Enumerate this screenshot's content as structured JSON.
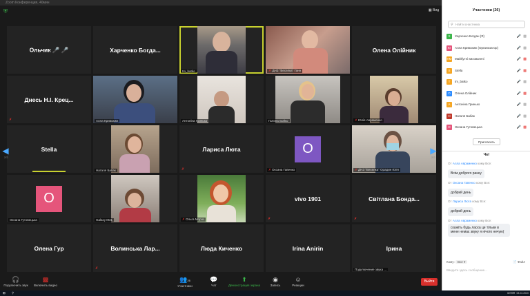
{
  "window": {
    "title": "Zoom Конференция, 40мин"
  },
  "top": {
    "view_label": "Вид"
  },
  "grid": {
    "tiles": [
      {
        "name": "Ольчик 🎤 🎤",
        "label": ""
      },
      {
        "name": "Харченко Богда...",
        "label": ""
      },
      {
        "name": "",
        "label": "tm_batko"
      },
      {
        "name": "",
        "label": "ДНЗ \"Веселка\" Ганн"
      },
      {
        "name": "Олена Олійник",
        "label": ""
      },
      {
        "name": "Днесь Н.І. Крец...",
        "label": ""
      },
      {
        "name": "",
        "label": "Алла Кривохиж"
      },
      {
        "name": "",
        "label": "Антоніна Гринько"
      },
      {
        "name": "",
        "label": "Галина Бойко"
      },
      {
        "name": "",
        "label": "Юлія Авраменко"
      },
      {
        "name": "Stella",
        "label": ""
      },
      {
        "name": "",
        "label": "Наталя Бабак"
      },
      {
        "name": "Лариса Люта",
        "label": ""
      },
      {
        "name": "",
        "label": "Оксана Гавенко"
      },
      {
        "name": "",
        "label": "ДНЗ \"Веселка\" Орадин Юля"
      },
      {
        "name": "",
        "label": "Оксана Гутовецька"
      },
      {
        "name": "",
        "label": "Galaxy M31"
      },
      {
        "name": "",
        "label": "Ольга Мороз"
      },
      {
        "name": "vivo 1901",
        "label": ""
      },
      {
        "name": "Світлана Бонда...",
        "label": ""
      },
      {
        "name": "Олена Гур",
        "label": ""
      },
      {
        "name": "Волинська Лар...",
        "label": ""
      },
      {
        "name": "Люда Киченко",
        "label": ""
      },
      {
        "name": "Irina Anirin",
        "label": ""
      },
      {
        "name": "Ірина",
        "label": "Подключение звука ..."
      }
    ],
    "avatar_letters": {
      "oksana_havenko": "O",
      "oksana_gutovetska": "O"
    },
    "page_left": "2/2",
    "page_right": "2/2"
  },
  "toolbar": {
    "audio": "Подключить звук",
    "video": "Включить видео",
    "participants": "Участники",
    "participants_count": "26",
    "chat": "Чат",
    "share": "Демонстрация экрана",
    "record": "Запись",
    "reactions": "Реакции",
    "end": "Выйти"
  },
  "panel": {
    "title": "Участники (26)",
    "search_placeholder": "Найти участника",
    "participants": [
      {
        "initial": "Х",
        "name": "Харченко Богдан (Я)",
        "color": "#3bb54a"
      },
      {
        "initial": "Ю",
        "name": "Алла Кривохиж (Организатор)",
        "color": "#e5557b"
      },
      {
        "initial": "НМ",
        "name": "Майбутні вихователі",
        "color": "#f5a623"
      },
      {
        "initial": "S",
        "name": "Stella",
        "color": "#f5a623"
      },
      {
        "initial": "T",
        "name": "tm_batko",
        "color": "#f5a623"
      },
      {
        "initial": "О",
        "name": "Олена Олійник",
        "color": "#2d8cff"
      },
      {
        "initial": "А",
        "name": "Антоніна Гринько",
        "color": "#f5a623"
      },
      {
        "initial": "Н",
        "name": "Наталя Бабак",
        "color": "#c0392b"
      },
      {
        "initial": "О",
        "name": "Оксана Гутовецька",
        "color": "#e5557b"
      }
    ],
    "invite": "Пригласить",
    "chat_title": "Чат",
    "from_label": "От",
    "to_label": "кому Все:",
    "messages": [
      {
        "who": "Алла Авраменко",
        "text": "Всім доброго ранку"
      },
      {
        "who": "Оксана Гавенко",
        "text": "добрий день"
      },
      {
        "who": "Лариса Люта",
        "text": "добрий день"
      },
      {
        "who": "Алла Авраменко",
        "text": "скажіть будь ласка це тільки в мене немає звуку я нічого нечую("
      }
    ],
    "to_prefix": "Кому:",
    "to_value": "Все",
    "file_label": "Файл",
    "input_placeholder": "Введите здесь сообщение..."
  },
  "taskbar": {
    "time": "10:09",
    "date": "08.04.2020"
  }
}
